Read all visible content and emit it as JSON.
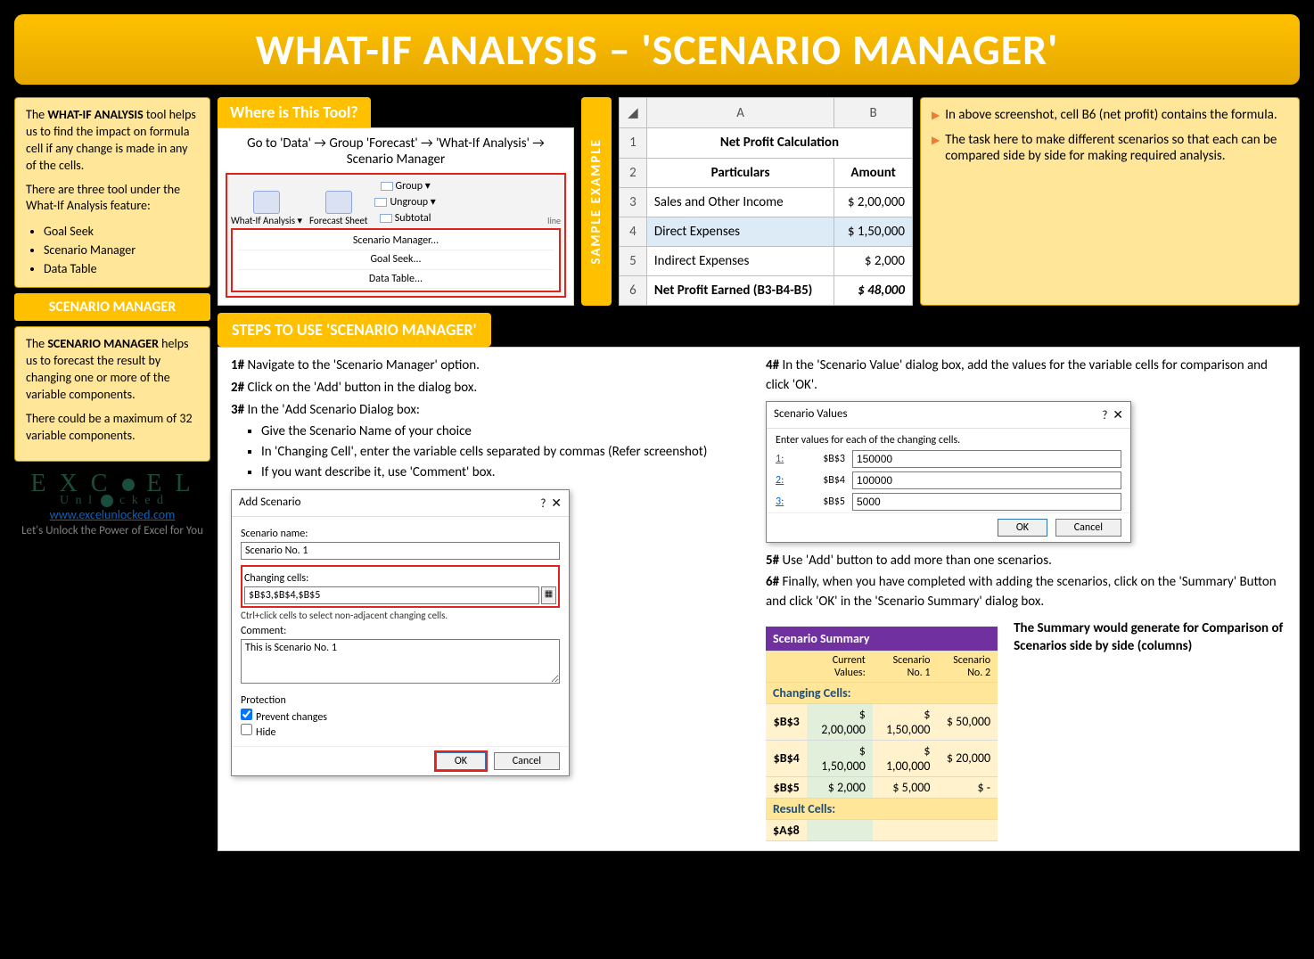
{
  "title": "WHAT-IF ANALYSIS – 'SCENARIO MANAGER'",
  "intro": {
    "p1": "The WHAT-IF ANALYSIS tool helps us to find the impact on formula cell if any change is made in any of the cells.",
    "p2": "There are three tool under the What-If Analysis feature:",
    "tools": [
      "Goal Seek",
      "Scenario Manager",
      "Data Table"
    ]
  },
  "scen_hdr": "SCENARIO MANAGER",
  "scen": {
    "p1": "The SCENARIO MANAGER helps us to forecast the result by changing one or more of the variable components.",
    "p2": "There could be a maximum of 32 variable components."
  },
  "brand": {
    "logo_top": "EXC  EL",
    "logo_sub": "Unl  cked",
    "url": "www.excelunlocked.com",
    "tag": "Let's Unlock the Power of Excel for You"
  },
  "where": {
    "hdr": "Where is This Tool?",
    "path": "Go to 'Data' → Group 'Forecast' → 'What-If Analysis' → Scenario Manager",
    "rib_btn1": "What-If Analysis ▾",
    "rib_btn2": "Forecast Sheet",
    "m1": "Group ▾",
    "m2": "Ungroup ▾",
    "m3": "Subtotal",
    "dd1": "Scenario Manager...",
    "dd2": "Goal Seek...",
    "dd3": "Data Table...",
    "outline": "line"
  },
  "sample_lbl": "SAMPLE EXAMPLE",
  "grid": {
    "colA": "A",
    "colB": "B",
    "r1": "Net Profit Calculation",
    "r2a": "Particulars",
    "r2b": "Amount",
    "rows": [
      {
        "n": "3",
        "a": "Sales and Other Income",
        "b": "$  2,00,000"
      },
      {
        "n": "4",
        "a": "Direct Expenses",
        "b": "$  1,50,000"
      },
      {
        "n": "5",
        "a": "Indirect Expenses",
        "b": "$       2,000"
      },
      {
        "n": "6",
        "a": "Net Profit Earned (B3-B4-B5)",
        "b": "$     48,000"
      }
    ]
  },
  "notes": {
    "n1": "In above screenshot, cell B6 (net profit) contains the formula.",
    "n2": "The task here to make different scenarios so that each can be compared side by side for making required analysis."
  },
  "steps_hdr": "STEPS TO USE 'SCENARIO MANAGER'",
  "steps_l": {
    "s1": "1# Navigate to the 'Scenario Manager' option.",
    "s2": "2# Click on the 'Add' button in the dialog box.",
    "s3": "3# In the 'Add Scenario Dialog box:",
    "b1": "Give the Scenario Name of your choice",
    "b2": "In 'Changing Cell', enter the variable cells separated by commas (Refer screenshot)",
    "b3": "If you want describe it, use 'Comment' box."
  },
  "add_dlg": {
    "title": "Add Scenario",
    "lbl_name": "Scenario name:",
    "val_name": "Scenario No. 1",
    "lbl_cells": "Changing cells:",
    "val_cells": "$B$3,$B$4,$B$5",
    "hint": "Ctrl+click cells to select non-adjacent changing cells.",
    "lbl_comment": "Comment:",
    "val_comment": "This is Scenario No. 1",
    "lbl_prot": "Protection",
    "chk1": "Prevent changes",
    "chk2": "Hide",
    "ok": "OK",
    "cancel": "Cancel"
  },
  "steps_r": {
    "s4": "4# In the 'Scenario Value' dialog box, add the values for the variable cells for comparison and click 'OK'.",
    "s5": "5# Use 'Add' button to add more than one scenarios.",
    "s6": "6# Finally, when you have completed with adding the scenarios, click on the 'Summary' Button and click 'OK' in the 'Scenario Summary' dialog box."
  },
  "sv_dlg": {
    "title": "Scenario Values",
    "prompt": "Enter values for each of the changing cells.",
    "rows": [
      {
        "k": "1:",
        "c": "$B$3",
        "v": "150000"
      },
      {
        "k": "2:",
        "c": "$B$4",
        "v": "100000"
      },
      {
        "k": "3:",
        "c": "$B$5",
        "v": "5000"
      }
    ],
    "ok": "OK",
    "cancel": "Cancel"
  },
  "summary": {
    "title": "Scenario Summary",
    "cols": [
      "Current Values:",
      "Scenario No. 1",
      "Scenario No. 2"
    ],
    "chg": "Changing Cells:",
    "rows": [
      {
        "l": "$B$3",
        "v": [
          "$    2,00,000",
          "$    1,50,000",
          "$       50,000"
        ]
      },
      {
        "l": "$B$4",
        "v": [
          "$    1,50,000",
          "$    1,00,000",
          "$       20,000"
        ]
      },
      {
        "l": "$B$5",
        "v": [
          "$         2,000",
          "$         5,000",
          "$              -"
        ]
      }
    ],
    "res": "Result Cells:",
    "res_l": "$A$8"
  },
  "side_note": "The Summary would generate for Comparison of Scenarios side by side (columns)"
}
